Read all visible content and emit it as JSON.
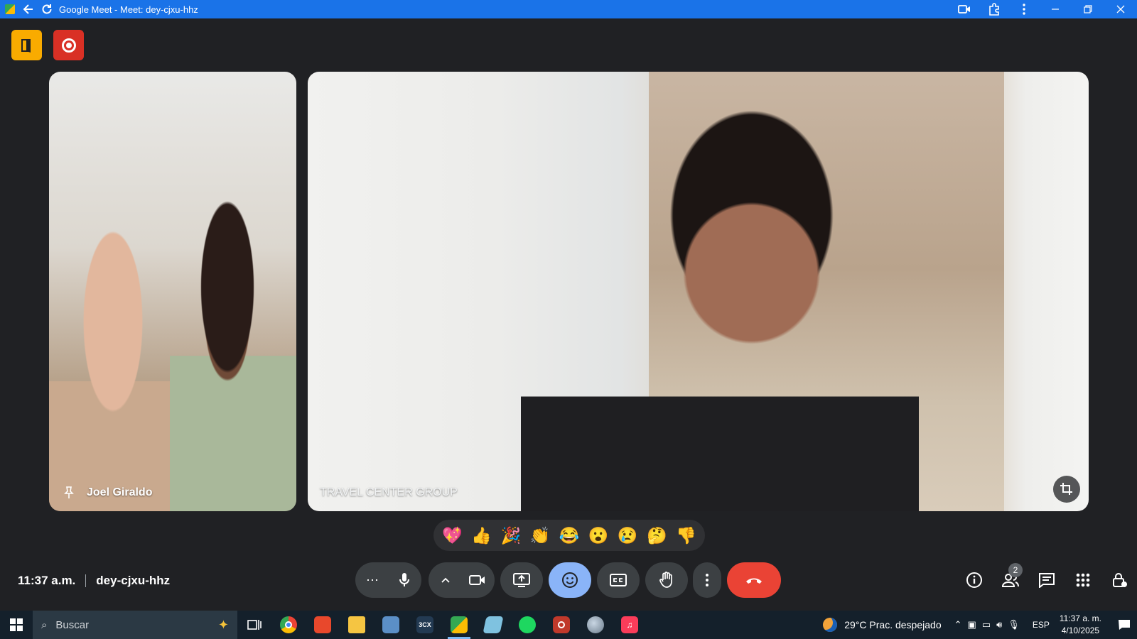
{
  "window": {
    "title": "Google Meet - Meet: dey-cjxu-hhz"
  },
  "tiles": [
    {
      "name": "Joel Giraldo"
    },
    {
      "name": "TRAVEL CENTER GROUP"
    }
  ],
  "reactions": [
    "💖",
    "👍",
    "🎉",
    "👏",
    "😂",
    "😮",
    "😢",
    "🤔",
    "👎"
  ],
  "meeting": {
    "time": "11:37 a.m.",
    "code": "dey-cjxu-hhz"
  },
  "controls": {
    "more_options_label": "⋯",
    "people_count": "2"
  },
  "taskbar": {
    "search_placeholder": "Buscar",
    "weather": "29°C  Prac. despejado",
    "language": "ESP",
    "clock_time": "11:37 a. m.",
    "clock_date": "4/10/2025"
  },
  "colors": {
    "titlebar": "#1a73e8",
    "background": "#202124",
    "control": "#3c4043",
    "reactions_active": "#8ab4f8",
    "leave": "#ea4335",
    "host_badge": "#f9ab00",
    "record_badge": "#d93025"
  }
}
